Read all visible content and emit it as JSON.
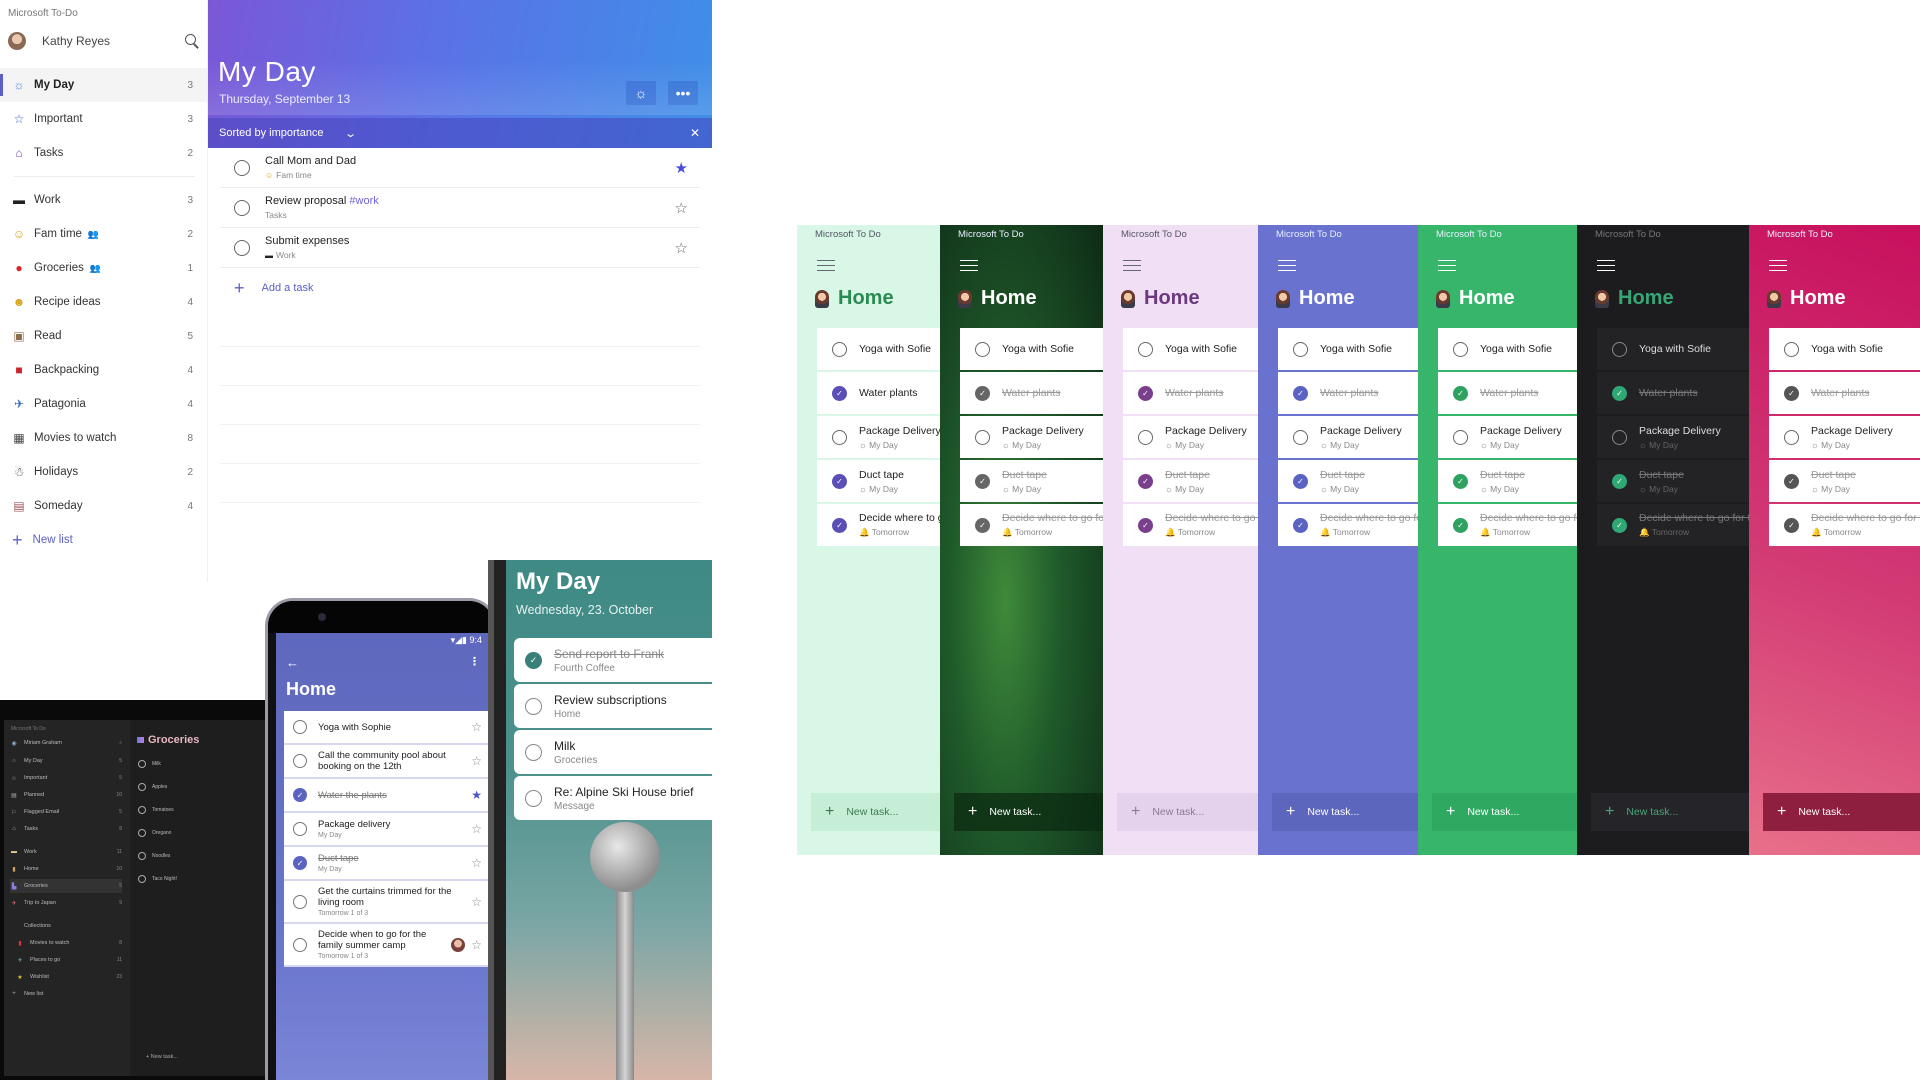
{
  "desktop": {
    "app_title": "Microsoft To-Do",
    "user_name": "Kathy Reyes",
    "nav_primary": [
      {
        "label": "My Day",
        "count": "3",
        "icon": "sun-icon",
        "active": true
      },
      {
        "label": "Important",
        "count": "3",
        "icon": "star-icon"
      },
      {
        "label": "Tasks",
        "count": "2",
        "icon": "home-check-icon"
      }
    ],
    "nav_lists": [
      {
        "label": "Work",
        "count": "3",
        "icon": "laptop-icon"
      },
      {
        "label": "Fam time",
        "count": "2",
        "icon": "smiley-icon",
        "shared": true
      },
      {
        "label": "Groceries",
        "count": "1",
        "icon": "apple-icon",
        "shared": true
      },
      {
        "label": "Recipe ideas",
        "count": "4",
        "icon": "yum-face-icon"
      },
      {
        "label": "Read",
        "count": "5",
        "icon": "book-icon"
      },
      {
        "label": "Backpacking",
        "count": "4",
        "icon": "backpack-icon"
      },
      {
        "label": "Patagonia",
        "count": "4",
        "icon": "map-icon"
      },
      {
        "label": "Movies to watch",
        "count": "8",
        "icon": "clapper-icon"
      },
      {
        "label": "Holidays",
        "count": "2",
        "icon": "snowman-icon"
      },
      {
        "label": "Someday",
        "count": "4",
        "icon": "calendar-icon"
      }
    ],
    "new_list_label": "New list",
    "main": {
      "title": "My Day",
      "date": "Thursday, September 13",
      "sort_label": "Sorted by importance",
      "tasks": [
        {
          "title": "Call Mom and Dad",
          "tag": "",
          "list": "Fam time",
          "starred": true
        },
        {
          "title": "Review proposal",
          "tag": "#work",
          "list": "Tasks",
          "starred": false
        },
        {
          "title": "Submit expenses",
          "tag": "",
          "list": "Work",
          "starred": false
        }
      ],
      "add_task_label": "Add a task"
    }
  },
  "tablet": {
    "app_title": "Microsoft To Do",
    "user_name": "Miriam Graham",
    "nav": [
      {
        "label": "My Day",
        "count": "5"
      },
      {
        "label": "Important",
        "count": "5"
      },
      {
        "label": "Planned",
        "count": "10"
      },
      {
        "label": "Flagged Email",
        "count": "5"
      },
      {
        "label": "Tasks",
        "count": "8"
      },
      {
        "label": "Work",
        "count": "11"
      },
      {
        "label": "Home",
        "count": "10"
      },
      {
        "label": "Groceries",
        "count": "5",
        "selected": true
      },
      {
        "label": "Trip to Japan",
        "count": "9"
      },
      {
        "label": "Collections",
        "count": ""
      },
      {
        "label": "Movies to watch",
        "count": "8"
      },
      {
        "label": "Places to go",
        "count": "11"
      },
      {
        "label": "Wishlist",
        "count": "23"
      },
      {
        "label": "New list",
        "count": ""
      }
    ],
    "list_title": "Groceries",
    "tasks": [
      "Milk",
      "Apples",
      "Tomatoes",
      "Oregano",
      "Noodles",
      "Taco Night!"
    ],
    "new_task_label": "New task..."
  },
  "android": {
    "status_time": "9:4",
    "title": "Home",
    "tasks": [
      {
        "title": "Yoga with Sophie",
        "sub": "",
        "done": false,
        "starred": false
      },
      {
        "title": "Call the community pool about booking on the 12th",
        "sub": "",
        "done": false,
        "starred": false
      },
      {
        "title": "Water the plants",
        "sub": "",
        "done": true,
        "starred": true
      },
      {
        "title": "Package delivery",
        "sub": "My Day",
        "done": false,
        "starred": false
      },
      {
        "title": "Duct tape",
        "sub": "My Day",
        "done": true,
        "starred": false
      },
      {
        "title": "Get the curtains trimmed for the living room",
        "sub": "Tomorrow 1 of 3",
        "done": false,
        "starred": false
      },
      {
        "title": "Decide when to go for the family summer camp",
        "sub": "Tomorrow 1 of 3",
        "done": false,
        "starred": false,
        "assigned": true
      }
    ]
  },
  "iphone": {
    "title": "My Day",
    "date": "Wednesday, 23. October",
    "tasks": [
      {
        "title": "Send report to Frank",
        "sub": "Fourth Coffee",
        "done": true
      },
      {
        "title": "Review subscriptions",
        "sub": "Home",
        "done": false
      },
      {
        "title": "Milk",
        "sub": "Groceries",
        "done": false
      },
      {
        "title": "Re: Alpine Ski House brief",
        "sub": "Message",
        "done": false
      }
    ]
  },
  "themes": {
    "app_title": "Microsoft To Do",
    "list_title": "Home",
    "new_task_label": "New task...",
    "tasks": [
      {
        "title": "Yoga with Sofie",
        "sub": ""
      },
      {
        "title": "Water plants",
        "sub": ""
      },
      {
        "title": "Package Delivery",
        "sub": "My Day"
      },
      {
        "title": "Duct tape",
        "sub": "My Day"
      },
      {
        "title": "Decide where to go for the",
        "sub": "Tomorrow"
      }
    ],
    "variants": [
      {
        "name": "mint",
        "bg": "#d9f7e6",
        "accent": "#2f9e5c",
        "title_color": "#2a8a52",
        "check": "#5b4fb6",
        "strike": false,
        "card": "#ffffff"
      },
      {
        "name": "fern",
        "bg": "#1f4d2b",
        "accent": "#ffffff",
        "title_color": "#ffffff",
        "check": "#666666",
        "strike": true,
        "card": "#ffffff"
      },
      {
        "name": "lavender",
        "bg": "#f1e0f5",
        "accent": "#6b3a7e",
        "title_color": "#6b3a7e",
        "check": "#7a3f8c",
        "strike": true,
        "card": "#ffffff"
      },
      {
        "name": "indigo",
        "bg": "#6a72cf",
        "accent": "#ffffff",
        "title_color": "#ffffff",
        "check": "#5a62c2",
        "strike": true,
        "card": "#ffffff"
      },
      {
        "name": "green",
        "bg": "#36b56b",
        "accent": "#ffffff",
        "title_color": "#ffffff",
        "check": "#2fa261",
        "strike": true,
        "card": "#ffffff"
      },
      {
        "name": "dark",
        "bg": "#1c1c1f",
        "accent": "#888888",
        "title_color": "#36a676",
        "check": "#2fa876",
        "strike": true,
        "card": "#232326"
      },
      {
        "name": "magenta",
        "bg": "#c81a66",
        "accent": "#ffffff",
        "title_color": "#ffffff",
        "check": "#555555",
        "strike": true,
        "card": "#ffffff"
      }
    ]
  }
}
